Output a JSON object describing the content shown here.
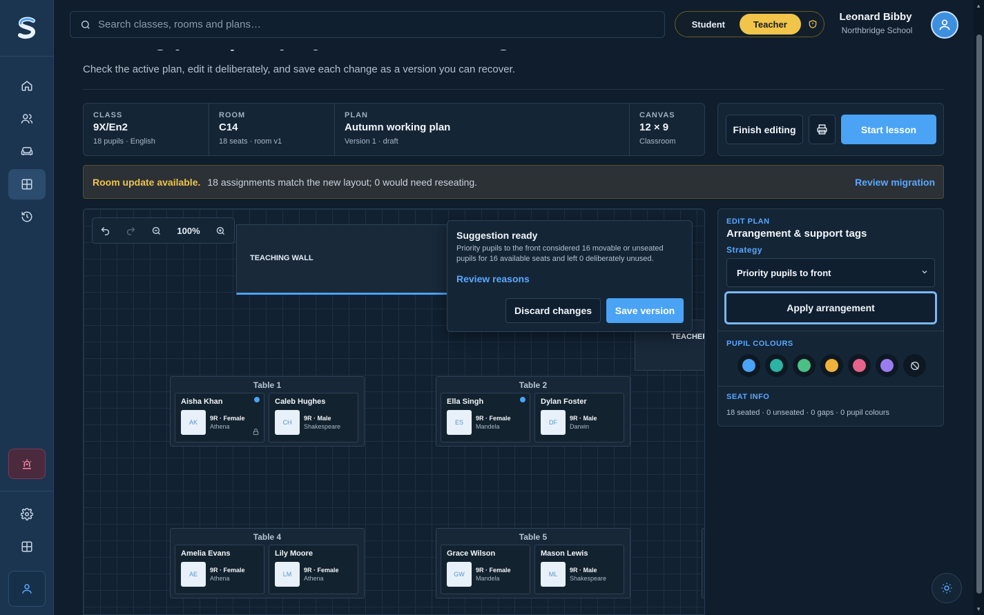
{
  "header": {
    "search_placeholder": "Search classes, rooms and plans…",
    "role_student": "Student",
    "role_teacher": "Teacher",
    "user_name": "Leonard Bibby",
    "user_school": "Northbridge School"
  },
  "page": {
    "title": "Seating plan | Display and edit seating plans effectively",
    "subtitle": "Check the active plan, edit it deliberately, and save each change as a version you can recover."
  },
  "info": {
    "class_label": "CLASS",
    "class_value": "9X/En2",
    "class_sub": "18 pupils · English",
    "room_label": "ROOM",
    "room_value": "C14",
    "room_sub": "18 seats · room v1",
    "plan_label": "PLAN",
    "plan_value": "Autumn working plan",
    "plan_sub": "Version 1 · draft",
    "canvas_label": "CANVAS",
    "canvas_value": "12 × 9",
    "canvas_sub": "Classroom"
  },
  "actions": {
    "finish": "Finish editing",
    "start": "Start lesson"
  },
  "banner": {
    "strong": "Room update available.",
    "text": "18 assignments match the new layout; 0 would need reseating.",
    "link": "Review migration"
  },
  "toolbar": {
    "zoom": "100%"
  },
  "canvas": {
    "board_label": "TEACHING WALL",
    "teacher_label": "TEACHER",
    "tables": [
      {
        "title": "Table 1",
        "seats": [
          {
            "name": "Aisha Khan",
            "initials": "AK",
            "meta": "9R · Female",
            "house": "Athena",
            "dot": true,
            "lock": true
          },
          {
            "name": "Caleb Hughes",
            "initials": "CH",
            "meta": "9R · Male",
            "house": "Shakespeare"
          }
        ]
      },
      {
        "title": "Table 2",
        "seats": [
          {
            "name": "Ella Singh",
            "initials": "ES",
            "meta": "9R · Female",
            "house": "Mandela",
            "dot": true
          },
          {
            "name": "Dylan Foster",
            "initials": "DF",
            "meta": "9R · Male",
            "house": "Darwin"
          }
        ]
      },
      {
        "title": "Table 4",
        "seats": [
          {
            "name": "Amelia Evans",
            "initials": "AE",
            "meta": "9R · Female",
            "house": "Athena"
          },
          {
            "name": "Lily Moore",
            "initials": "LM",
            "meta": "9R · Female",
            "house": "Athena"
          }
        ]
      },
      {
        "title": "Table 5",
        "seats": [
          {
            "name": "Grace Wilson",
            "initials": "GW",
            "meta": "9R · Female",
            "house": "Mandela"
          },
          {
            "name": "Mason Lewis",
            "initials": "ML",
            "meta": "9R · Male",
            "house": "Shakespeare"
          }
        ]
      }
    ]
  },
  "popover": {
    "title": "Suggestion ready",
    "text": "Priority pupils to the front considered 16 movable or unseated pupils for 16 available seats and left 0 deliberately unused.",
    "link": "Review reasons",
    "discard": "Discard changes",
    "save": "Save version"
  },
  "edit_panel": {
    "label": "EDIT PLAN",
    "heading": "Arrangement & support tags",
    "strategy_label": "Strategy",
    "strategy_value": "Priority pupils to front",
    "apply": "Apply arrangement",
    "colours_label": "PUPIL COLOURS",
    "colours": [
      "#4aa3f5",
      "#2bb3a3",
      "#4cbf84",
      "#f0b23a",
      "#e8638a",
      "#9b7cf0"
    ],
    "seat_info_label": "SEAT INFO",
    "seat_info_text": "18 seated · 0 unseated · 0 gaps · 0 pupil colours"
  }
}
